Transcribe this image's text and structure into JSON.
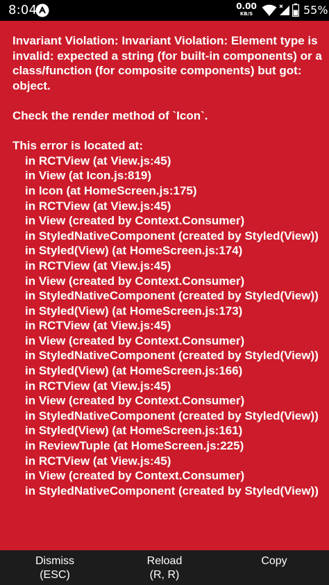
{
  "status_bar": {
    "time": "8:04",
    "net_speed_value": "0.00",
    "net_speed_unit": "KB/S",
    "battery": "55%",
    "battery_level": 0.55,
    "icons": [
      "app-notification-icon",
      "wifi-icon",
      "cell-signal-icon",
      "battery-icon"
    ]
  },
  "error": {
    "message": "Invariant Violation: Invariant Violation: Element type is invalid: expected a string (for built-in components) or a class/function (for composite components) but got: object.",
    "render_hint": "Check the render method of `Icon`.",
    "location_heading": "This error is located at:",
    "stack": [
      "in RCTView (at View.js:45)",
      "in View (at Icon.js:819)",
      "in Icon (at HomeScreen.js:175)",
      "in RCTView (at View.js:45)",
      "in View (created by Context.Consumer)",
      "in StyledNativeComponent (created by Styled(View))",
      "in Styled(View) (at HomeScreen.js:174)",
      "in RCTView (at View.js:45)",
      "in View (created by Context.Consumer)",
      "in StyledNativeComponent (created by Styled(View))",
      "in Styled(View) (at HomeScreen.js:173)",
      "in RCTView (at View.js:45)",
      "in View (created by Context.Consumer)",
      "in StyledNativeComponent (created by Styled(View))",
      "in Styled(View) (at HomeScreen.js:166)",
      "in RCTView (at View.js:45)",
      "in View (created by Context.Consumer)",
      "in StyledNativeComponent (created by Styled(View))",
      "in Styled(View) (at HomeScreen.js:161)",
      "in ReviewTuple (at HomeScreen.js:225)",
      "in RCTView (at View.js:45)",
      "in View (created by Context.Consumer)",
      "in StyledNativeComponent (created by Styled(View))"
    ]
  },
  "actions": [
    {
      "name": "dismiss-button",
      "line1": "Dismiss",
      "line2": "(ESC)"
    },
    {
      "name": "reload-button",
      "line1": "Reload",
      "line2": "(R, R)"
    },
    {
      "name": "copy-button",
      "line1": "Copy",
      "line2": ""
    }
  ],
  "colors": {
    "error_background": "#cc1b2a",
    "action_bar_background": "#1c1c1c",
    "text": "#ffffff"
  }
}
